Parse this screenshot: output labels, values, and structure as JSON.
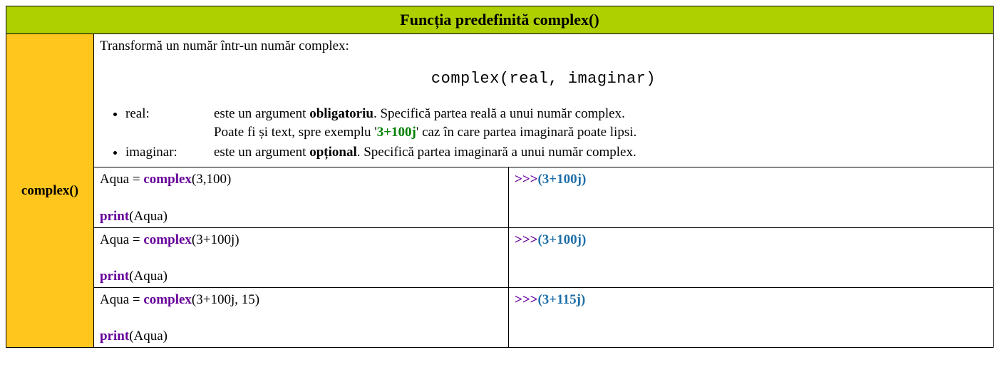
{
  "title": "Funcția predefinită complex()",
  "side_label": "complex()",
  "description": {
    "intro": "Transformă un număr într-un număr complex:",
    "signature": "complex(real, imaginar)",
    "args": {
      "real": {
        "name": "real:",
        "line1_pre": "este un argument ",
        "line1_bold": "obligatoriu",
        "line1_post": ". Specifică partea reală a unui număr complex.",
        "line2_pre": "Poate fi și text, spre exemplu '",
        "line2_code": "3+100j",
        "line2_post": "' caz în  care partea imaginară poate lipsi."
      },
      "imaginar": {
        "name": "imaginar:",
        "line1_pre": "este un argument ",
        "line1_bold": "opțional",
        "line1_post": ". Specifică partea imaginară a unui număr complex."
      }
    }
  },
  "examples": [
    {
      "assign_pre": "Aqua = ",
      "func": "complex",
      "args": "(3,100)",
      "print_kw": "print",
      "print_args": "(Aqua)",
      "out_prefix": ">>>",
      "out_value": "(3+100j)"
    },
    {
      "assign_pre": "Aqua = ",
      "func": "complex",
      "args": "(3+100j)",
      "print_kw": "print",
      "print_args": "(Aqua)",
      "out_prefix": ">>>",
      "out_value": "(3+100j)"
    },
    {
      "assign_pre": "Aqua = ",
      "func": "complex",
      "args": "(3+100j, 15)",
      "print_kw": "print",
      "print_args": "(Aqua)",
      "out_prefix": ">>>",
      "out_value": "(3+115j)"
    }
  ]
}
